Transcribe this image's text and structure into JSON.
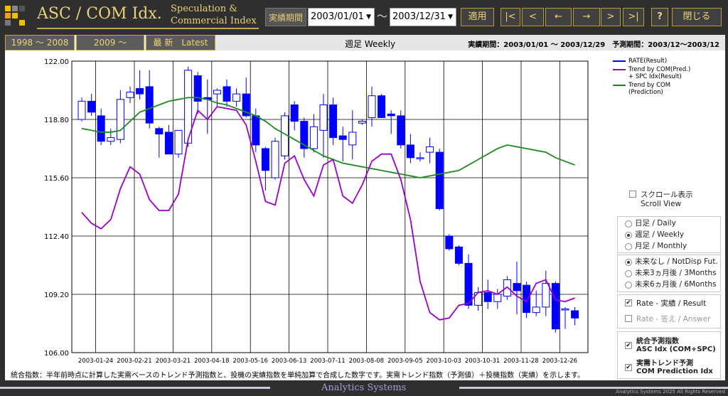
{
  "header": {
    "title": "ASC / COM Idx.",
    "subtitle_line1": "Speculation &",
    "subtitle_line2": "Commercial Index",
    "period_label": "実績期間",
    "start_date": "2003/01/01",
    "tilde": "～",
    "end_date": "2003/12/31",
    "apply_label": "適用",
    "nav_first": "|<",
    "nav_prev": "<",
    "nav_back": "←",
    "nav_fwd": "→",
    "nav_next": ">",
    "nav_last": ">|",
    "help_label": "?",
    "close_label": "閉じる"
  },
  "tabs": {
    "tab1": "1998 ～ 2008",
    "tab2": "2009 ～",
    "tab3": "最 新　Latest",
    "weekly": "週足 Weekly",
    "period_info": "実績期間：2003/01/01 ～ 2003/12/29　予測期間：2003/12～2003/12"
  },
  "legend": {
    "rate": "RATE(Result)",
    "trend_com_1": "Trend by COM(Pred.)",
    "trend_com_2": "+ SPC Idx(Result)",
    "trend_pred_1": "Trend by COM",
    "trend_pred_2": "(Prediction)"
  },
  "controls": {
    "scroll_jp": "スクロール表示",
    "scroll_en": "Scroll View",
    "daily": "日足 / Daily",
    "weekly": "週足 / Weekly",
    "monthly": "月足 / Monthly",
    "selected_period": "weekly",
    "fut_none": "未来なし / NotDisp Fut.",
    "fut_3m": "未来3ヵ月後 / 3Months",
    "fut_6m": "未来6ヵ月後 / 6Months",
    "selected_future": "none",
    "rate_result": "Rate - 実績 / Result",
    "rate_answer": "Rate - 答え / Answer",
    "asc_1": "統合予測指数",
    "asc_2": "ASC Idx (COM+SPC)",
    "com_1": "実需トレンド予測",
    "com_2": "COM Prediction Idx"
  },
  "footnote": "統合指数：半年前時点に計算した実需ベースのトレンド予測指数と、投機の実績指数を単純加算で合成した数字です。実需トレンド指数（予測値）＋投機指数（実績）を示します。",
  "footer": {
    "title": "Analytics Systems",
    "copyright": "Analytics Systems 2025 All Rights Reserved"
  },
  "colors": {
    "rate_fill": "#0000ff",
    "trend_com": "#9b00c8",
    "trend_pred": "#1f8c1f",
    "accent": "#e8d07a"
  },
  "chart_data": {
    "type": "candlestick",
    "ylim": [
      106.0,
      122.0
    ],
    "yticks": [
      "122.00",
      "118.80",
      "115.60",
      "112.40",
      "109.20",
      "106.00"
    ],
    "xticks": [
      "2003-01-24",
      "2003-02-21",
      "2003-03-21",
      "2003-04-18",
      "2003-05-16",
      "2003-06-13",
      "2003-07-11",
      "2003-08-08",
      "2003-09-05",
      "2003-10-03",
      "2003-10-31",
      "2003-11-28",
      "2003-12-26"
    ],
    "weeks": 52,
    "candles": [
      {
        "o": 118.8,
        "h": 120.0,
        "l": 118.7,
        "c": 119.8
      },
      {
        "o": 119.8,
        "h": 120.2,
        "l": 119.0,
        "c": 119.2
      },
      {
        "o": 119.0,
        "h": 119.4,
        "l": 117.4,
        "c": 117.6
      },
      {
        "o": 117.6,
        "h": 118.3,
        "l": 117.4,
        "c": 117.8
      },
      {
        "o": 117.7,
        "h": 120.4,
        "l": 117.5,
        "c": 119.9
      },
      {
        "o": 120.0,
        "h": 120.6,
        "l": 119.7,
        "c": 120.3
      },
      {
        "o": 120.5,
        "h": 121.5,
        "l": 119.9,
        "c": 120.2
      },
      {
        "o": 120.6,
        "h": 121.5,
        "l": 118.3,
        "c": 118.6
      },
      {
        "o": 118.3,
        "h": 118.4,
        "l": 116.7,
        "c": 118.0
      },
      {
        "o": 118.1,
        "h": 118.5,
        "l": 117.0,
        "c": 116.9
      },
      {
        "o": 116.9,
        "h": 118.2,
        "l": 116.7,
        "c": 118.2
      },
      {
        "o": 117.5,
        "h": 121.7,
        "l": 117.3,
        "c": 121.5
      },
      {
        "o": 121.2,
        "h": 121.4,
        "l": 119.1,
        "c": 119.8
      },
      {
        "o": 120.0,
        "h": 121.0,
        "l": 118.0,
        "c": 119.9
      },
      {
        "o": 120.2,
        "h": 120.5,
        "l": 119.5,
        "c": 120.4
      },
      {
        "o": 120.6,
        "h": 121.0,
        "l": 119.5,
        "c": 119.8
      },
      {
        "o": 119.8,
        "h": 120.5,
        "l": 119.5,
        "c": 120.2
      },
      {
        "o": 120.2,
        "h": 121.1,
        "l": 118.9,
        "c": 119.0
      },
      {
        "o": 119.0,
        "h": 119.4,
        "l": 117.0,
        "c": 117.4
      },
      {
        "o": 117.2,
        "h": 117.3,
        "l": 114.9,
        "c": 116.0
      },
      {
        "o": 115.6,
        "h": 117.8,
        "l": 115.5,
        "c": 117.6
      },
      {
        "o": 116.8,
        "h": 119.2,
        "l": 116.6,
        "c": 119.0
      },
      {
        "o": 119.6,
        "h": 119.8,
        "l": 118.2,
        "c": 118.7
      },
      {
        "o": 118.7,
        "h": 118.9,
        "l": 116.7,
        "c": 117.2
      },
      {
        "o": 117.2,
        "h": 119.1,
        "l": 117.0,
        "c": 118.4
      },
      {
        "o": 118.2,
        "h": 120.2,
        "l": 116.7,
        "c": 119.6
      },
      {
        "o": 119.6,
        "h": 120.0,
        "l": 117.4,
        "c": 117.8
      },
      {
        "o": 117.9,
        "h": 118.4,
        "l": 116.5,
        "c": 117.7
      },
      {
        "o": 117.4,
        "h": 119.3,
        "l": 116.6,
        "c": 118.1
      },
      {
        "o": 118.6,
        "h": 118.8,
        "l": 118.5,
        "c": 118.7
      },
      {
        "o": 118.9,
        "h": 120.6,
        "l": 118.4,
        "c": 120.1
      },
      {
        "o": 120.1,
        "h": 120.2,
        "l": 118.9,
        "c": 118.9
      },
      {
        "o": 119.1,
        "h": 119.3,
        "l": 118.0,
        "c": 119.0
      },
      {
        "o": 119.0,
        "h": 119.3,
        "l": 117.2,
        "c": 117.4
      },
      {
        "o": 117.4,
        "h": 118.0,
        "l": 116.4,
        "c": 116.7
      },
      {
        "o": 116.7,
        "h": 117.0,
        "l": 116.5,
        "c": 116.7
      },
      {
        "o": 117.0,
        "h": 117.8,
        "l": 116.4,
        "c": 117.3
      },
      {
        "o": 117.0,
        "h": 117.2,
        "l": 113.8,
        "c": 113.9
      },
      {
        "o": 112.4,
        "h": 112.5,
        "l": 111.6,
        "c": 111.7
      },
      {
        "o": 111.8,
        "h": 111.9,
        "l": 110.8,
        "c": 110.9
      },
      {
        "o": 110.9,
        "h": 111.4,
        "l": 108.4,
        "c": 108.6
      },
      {
        "o": 108.6,
        "h": 109.6,
        "l": 108.3,
        "c": 109.3
      },
      {
        "o": 109.3,
        "h": 110.0,
        "l": 108.4,
        "c": 108.8
      },
      {
        "o": 108.8,
        "h": 109.5,
        "l": 108.4,
        "c": 109.2
      },
      {
        "o": 109.1,
        "h": 110.2,
        "l": 108.9,
        "c": 110.0
      },
      {
        "o": 109.8,
        "h": 111.0,
        "l": 108.1,
        "c": 109.4
      },
      {
        "o": 109.7,
        "h": 109.9,
        "l": 107.9,
        "c": 108.2
      },
      {
        "o": 108.2,
        "h": 109.4,
        "l": 108.0,
        "c": 108.5
      },
      {
        "o": 108.5,
        "h": 110.5,
        "l": 108.0,
        "c": 109.8
      },
      {
        "o": 109.8,
        "h": 109.9,
        "l": 107.1,
        "c": 107.3
      },
      {
        "o": 108.4,
        "h": 108.5,
        "l": 107.3,
        "c": 108.4
      },
      {
        "o": 108.3,
        "h": 108.5,
        "l": 107.5,
        "c": 107.9
      }
    ],
    "trend_com_pred_spc": [
      113.7,
      113.1,
      112.8,
      113.3,
      115.0,
      116.2,
      115.8,
      114.4,
      113.8,
      113.8,
      114.7,
      117.7,
      119.3,
      118.8,
      119.5,
      119.4,
      119.3,
      118.5,
      116.5,
      114.3,
      114.1,
      116.4,
      116.8,
      115.5,
      114.6,
      116.3,
      116.6,
      114.6,
      114.2,
      115.2,
      116.5,
      116.9,
      116.9,
      115.5,
      113.3,
      109.9,
      108.2,
      107.8,
      107.9,
      108.6,
      108.7,
      109.3,
      109.4,
      109.2,
      109.6,
      109.1,
      108.8,
      109.8,
      110.0,
      108.9,
      108.8,
      109.0
    ],
    "trend_com_prediction": [
      118.3,
      118.2,
      118.1,
      118.1,
      118.2,
      118.7,
      119.2,
      119.4,
      119.6,
      119.8,
      119.9,
      120.0,
      120.0,
      119.9,
      119.7,
      119.6,
      119.4,
      119.2,
      119.0,
      118.7,
      118.3,
      118.0,
      117.7,
      117.4,
      117.1,
      116.8,
      116.6,
      116.4,
      116.3,
      116.2,
      116.1,
      116.0,
      115.9,
      115.8,
      115.7,
      115.6,
      115.7,
      115.8,
      115.9,
      116.0,
      116.3,
      116.6,
      116.9,
      117.2,
      117.4,
      117.3,
      117.2,
      117.1,
      117.0,
      116.7,
      116.5,
      116.3
    ]
  }
}
